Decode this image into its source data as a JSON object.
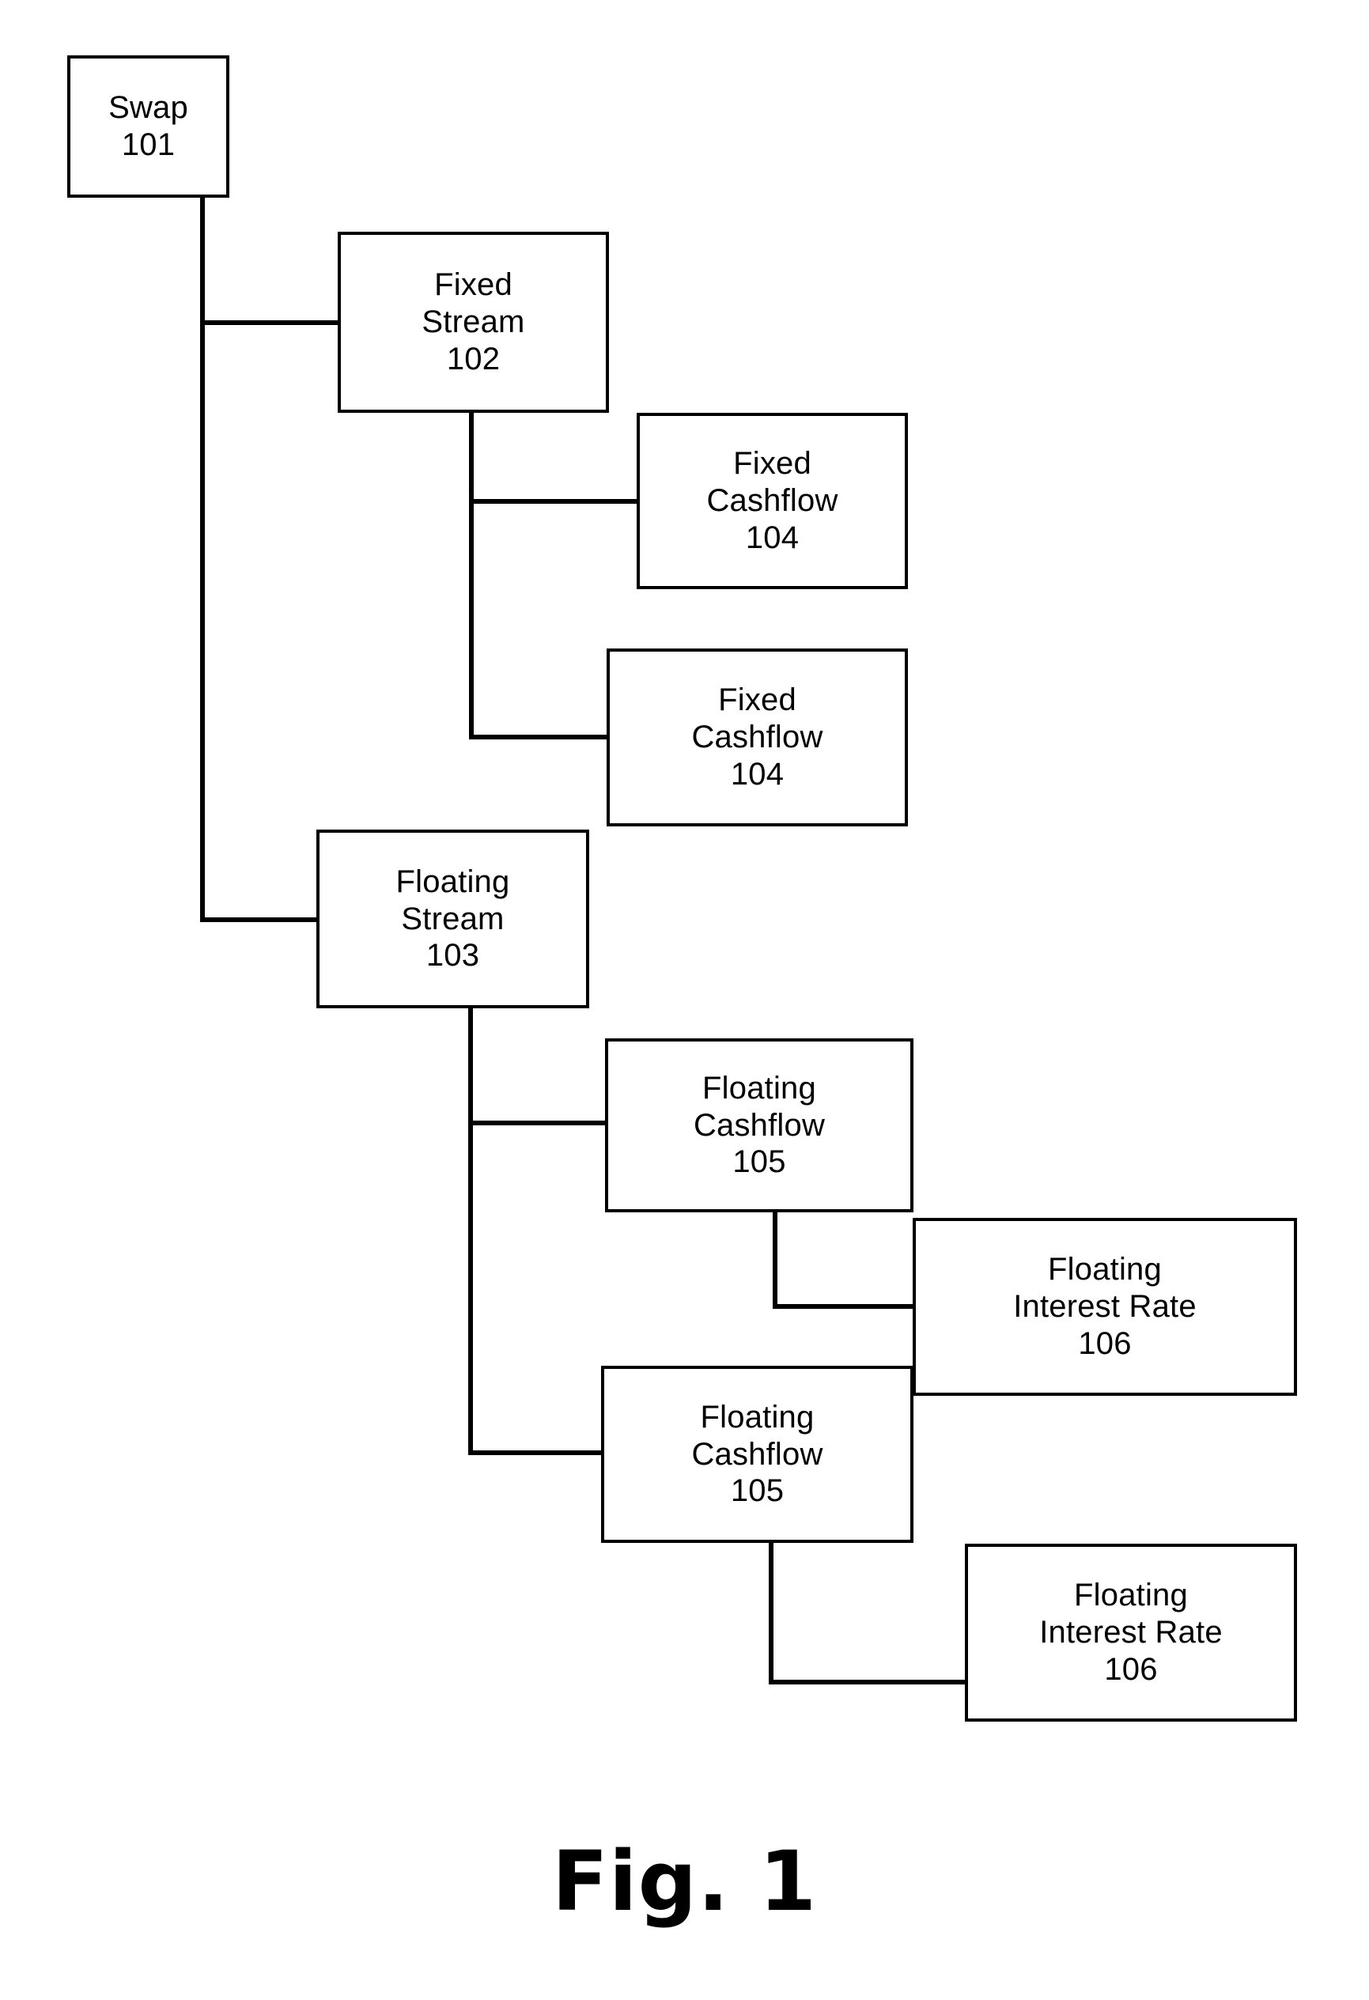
{
  "figure": {
    "caption": "Fig. 1",
    "stroke_color": "#000000",
    "background_color": "#ffffff"
  },
  "nodes": {
    "swap": {
      "title": "Swap",
      "ref": "101"
    },
    "fixed_stream": {
      "title_line1": "Fixed",
      "title_line2": "Stream",
      "ref": "102"
    },
    "fixed_cashflow_1": {
      "title_line1": "Fixed",
      "title_line2": "Cashflow",
      "ref": "104"
    },
    "fixed_cashflow_2": {
      "title_line1": "Fixed",
      "title_line2": "Cashflow",
      "ref": "104"
    },
    "floating_stream": {
      "title_line1": "Floating",
      "title_line2": "Stream",
      "ref": "103"
    },
    "floating_cashflow_1": {
      "title_line1": "Floating",
      "title_line2": "Cashflow",
      "ref": "105"
    },
    "floating_cashflow_2": {
      "title_line1": "Floating",
      "title_line2": "Cashflow",
      "ref": "105"
    },
    "floating_rate_1": {
      "title_line1": "Floating",
      "title_line2": "Interest Rate",
      "ref": "106"
    },
    "floating_rate_2": {
      "title_line1": "Floating",
      "title_line2": "Interest Rate",
      "ref": "106"
    }
  },
  "edges": [
    {
      "from": "swap",
      "to": "fixed_stream"
    },
    {
      "from": "swap",
      "to": "floating_stream"
    },
    {
      "from": "fixed_stream",
      "to": "fixed_cashflow_1"
    },
    {
      "from": "fixed_stream",
      "to": "fixed_cashflow_2"
    },
    {
      "from": "floating_stream",
      "to": "floating_cashflow_1"
    },
    {
      "from": "floating_stream",
      "to": "floating_cashflow_2"
    },
    {
      "from": "floating_cashflow_1",
      "to": "floating_rate_1"
    },
    {
      "from": "floating_cashflow_2",
      "to": "floating_rate_2"
    }
  ]
}
